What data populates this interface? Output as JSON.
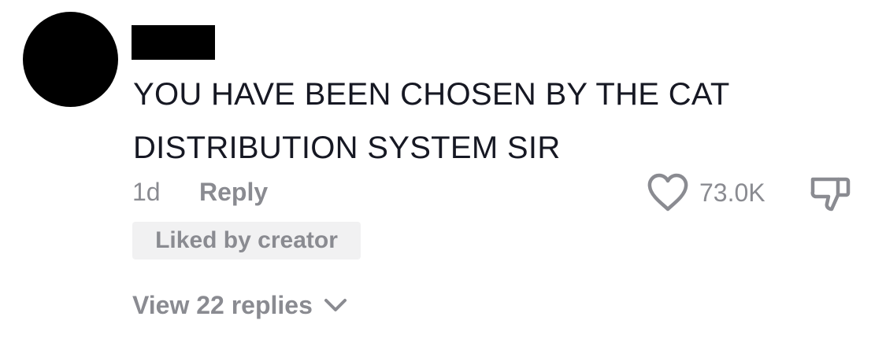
{
  "comment": {
    "text": "YOU HAVE BEEN CHOSEN BY THE CAT DISTRIBUTION SYSTEM SIR",
    "timestamp": "1d",
    "reply_label": "Reply",
    "like_count": "73.0K",
    "liked_by_creator_label": "Liked by creator",
    "view_replies_label": "View 22 replies",
    "avatar_icon": "avatar-redacted",
    "username_redacted": true
  },
  "colors": {
    "primary_text": "#161823",
    "secondary_text": "#8a8b91",
    "badge_background": "#f1f1f2",
    "redaction": "#000000"
  }
}
